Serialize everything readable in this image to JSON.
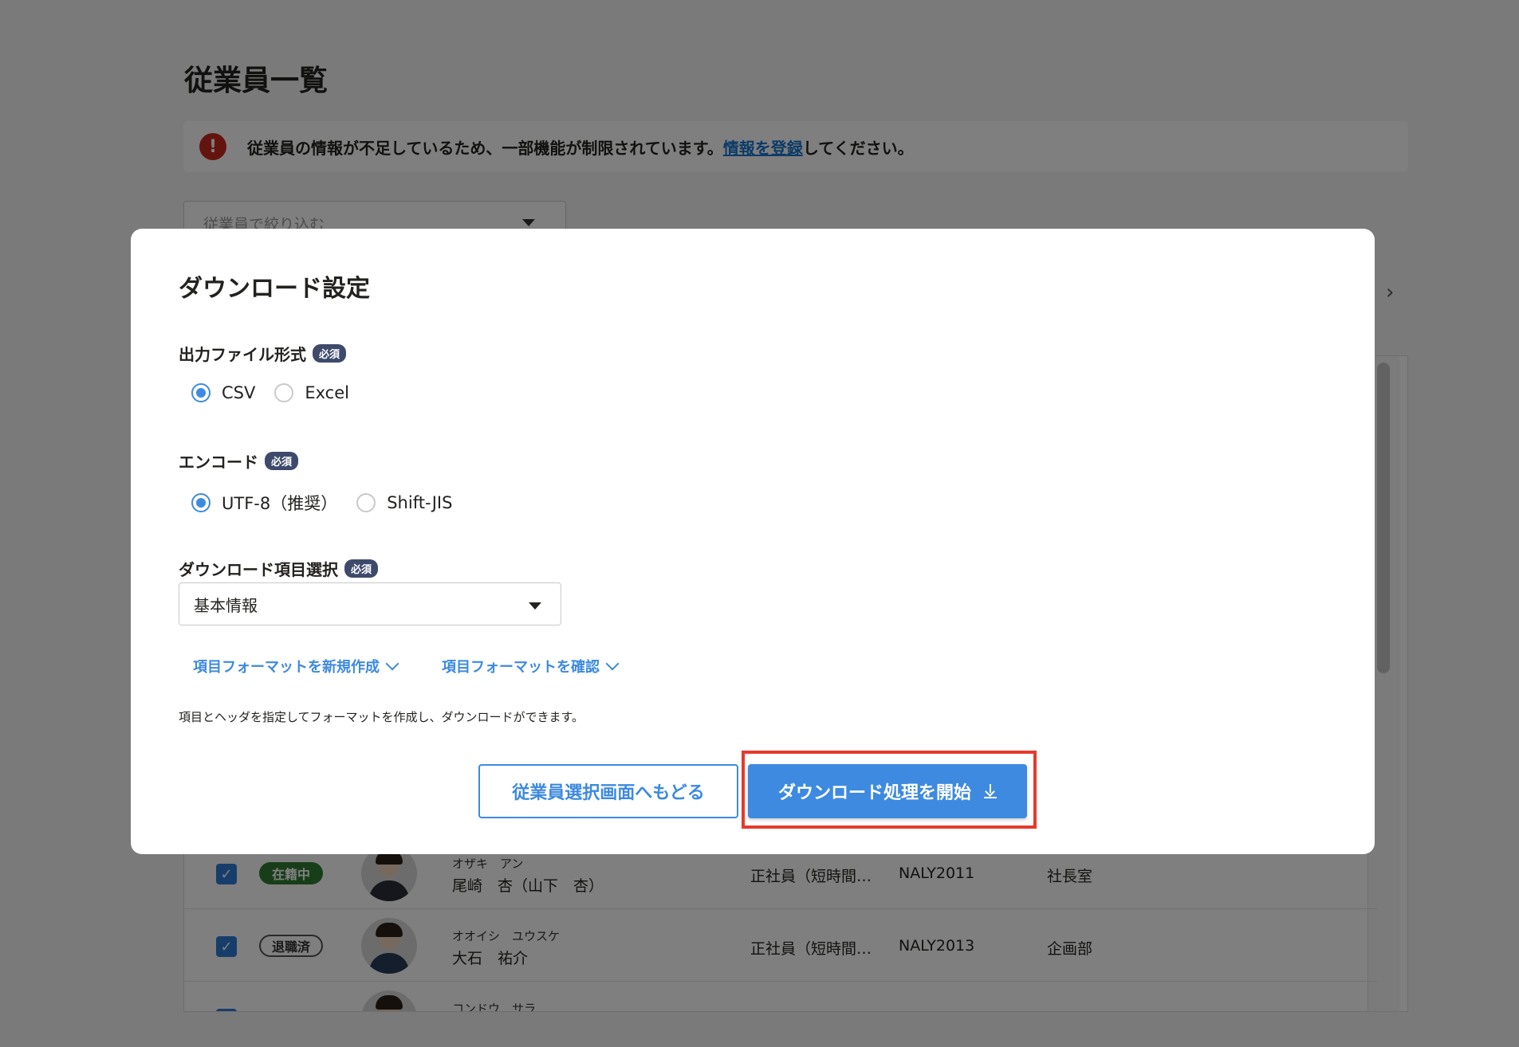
{
  "page": {
    "title": "従業員一覧",
    "alert": {
      "text_before": "従業員の情報が不足しているため、一部機能が制限されています。",
      "link": "情報を登録",
      "text_after": "してください。"
    },
    "filter_placeholder": "従業員で絞り込む",
    "rows": [
      {
        "status": "在籍中",
        "kana": "オザキ　アン",
        "name": "尾崎　杏（山下　杏）",
        "employment": "正社員（短時間…",
        "code": "NALY2011",
        "dept": "社長室"
      },
      {
        "status": "退職済",
        "kana": "オオイシ　ユウスケ",
        "name": "大石　祐介",
        "employment": "正社員（短時間…",
        "code": "NALY2013",
        "dept": "企画部"
      },
      {
        "status": "",
        "kana": "コンドウ　サラ",
        "name": "",
        "employment": "",
        "code": "",
        "dept": ""
      }
    ]
  },
  "modal": {
    "title": "ダウンロード設定",
    "required_badge": "必須",
    "file_format": {
      "label": "出力ファイル形式",
      "options": [
        "CSV",
        "Excel"
      ],
      "selected": "CSV"
    },
    "encoding": {
      "label": "エンコード",
      "options": [
        "UTF-8（推奨）",
        "Shift-JIS"
      ],
      "selected": "UTF-8（推奨）"
    },
    "items": {
      "label": "ダウンロード項目選択",
      "value": "基本情報"
    },
    "links": {
      "new_format": "項目フォーマットを新規作成",
      "check_format": "項目フォーマットを確認"
    },
    "helper": "項目とヘッダを指定してフォーマットを作成し、ダウンロードができます。",
    "buttons": {
      "back": "従業員選択画面へもどる",
      "start": "ダウンロード処理を開始"
    }
  },
  "colors": {
    "primary": "#3d8ae0",
    "highlight": "#e53a2d",
    "alert": "#c8281e"
  }
}
